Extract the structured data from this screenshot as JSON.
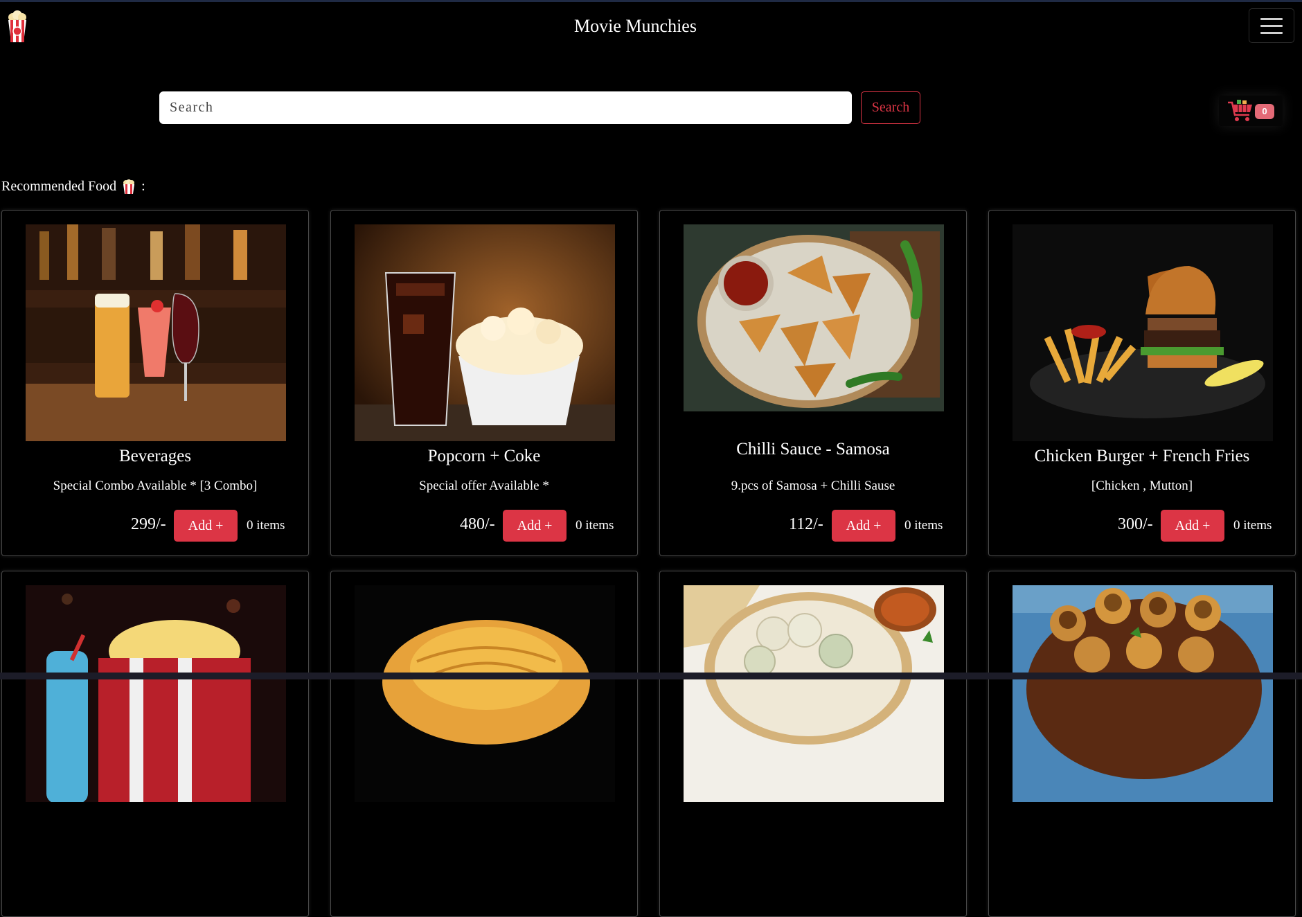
{
  "nav": {
    "brand": "Movie Munchies",
    "logo_icon": "popcorn-icon",
    "menu_icon": "hamburger-menu-icon"
  },
  "search": {
    "placeholder": "Search",
    "button_label": "Search"
  },
  "cart": {
    "icon": "shopping-cart-icon",
    "count": "0"
  },
  "section": {
    "title": "Recommended Food",
    "icon": "popcorn-icon",
    "suffix": ":"
  },
  "colors": {
    "accent": "#dc3545",
    "badge": "#e46a77",
    "background": "#000000"
  },
  "products": [
    {
      "title": "Beverages",
      "desc": "Special Combo Available * [3 Combo]",
      "price": "299/-",
      "add_label": "Add +",
      "count": "0 items",
      "image": "beverages-photo"
    },
    {
      "title": "Popcorn + Coke",
      "desc": "Special offer Available *",
      "price": "480/-",
      "add_label": "Add +",
      "count": "0 items",
      "image": "popcorn-coke-photo"
    },
    {
      "title": "Chilli Sauce - Samosa",
      "desc": "9.pcs of Samosa + Chilli Sause",
      "price": "112/-",
      "add_label": "Add +",
      "count": "0 items",
      "image": "samosa-photo"
    },
    {
      "title": "Chicken Burger + French Fries",
      "desc": "[Chicken , Mutton]",
      "price": "300/-",
      "add_label": "Add +",
      "count": "0 items",
      "image": "burger-fries-photo"
    }
  ],
  "products_row2_images": [
    "popcorn-drink-photo",
    "noodles-photo",
    "momos-photo",
    "pani-puri-photo"
  ]
}
